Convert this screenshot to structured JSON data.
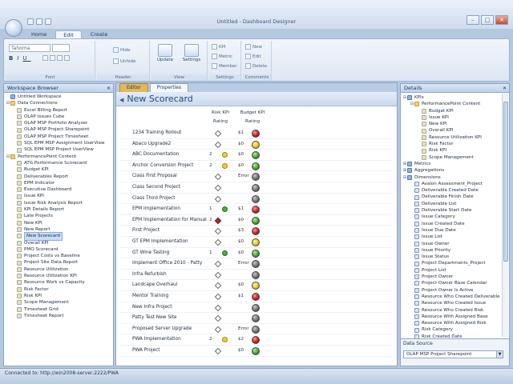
{
  "window": {
    "title": "Untitled - Dashboard Designer"
  },
  "ribbon": {
    "tabs": [
      "Home",
      "Edit",
      "Create"
    ],
    "active_tab": "Edit",
    "font": {
      "name": "Tahoma",
      "size": "",
      "group_label": "Font"
    },
    "header": {
      "hide": "Hide",
      "unhide": "Unhide",
      "group_label": "Header"
    },
    "view": {
      "update": "Update",
      "settings": "Settings",
      "group_label": "View"
    },
    "settings": {
      "kpi": "KPI",
      "metric": "Metric",
      "member": "Member",
      "group_label": "Settings"
    },
    "comments": {
      "new": "New",
      "edit": "Edit",
      "delete": "Delete",
      "group_label": "Comments"
    }
  },
  "workspace": {
    "title": "Workspace Browser",
    "items": [
      {
        "label": "Untitled Workspace",
        "level": 0,
        "icon": "workspace"
      },
      {
        "label": "Data Connections",
        "level": 0,
        "icon": "folder",
        "toggle": "⊟"
      },
      {
        "label": "Excel Billing Report",
        "level": 1,
        "icon": "item"
      },
      {
        "label": "OLAP Issues Cube",
        "level": 1,
        "icon": "item"
      },
      {
        "label": "OLAP MSP Portfolio Analyzer",
        "level": 1,
        "icon": "item"
      },
      {
        "label": "OLAP MSP Project Sharepoint",
        "level": 1,
        "icon": "item"
      },
      {
        "label": "OLAP MSP Project Timesheet",
        "level": 1,
        "icon": "item"
      },
      {
        "label": "SQL EPM MSP Assignment UserView",
        "level": 1,
        "icon": "item"
      },
      {
        "label": "SQL EPM MSP Project UserView",
        "level": 1,
        "icon": "item"
      },
      {
        "label": "PerformancePoint Content",
        "level": 0,
        "icon": "folder",
        "toggle": "⊟"
      },
      {
        "label": "ATG Performance Scorecard",
        "level": 1,
        "icon": "item"
      },
      {
        "label": "Budget KPI",
        "level": 1,
        "icon": "item"
      },
      {
        "label": "Deliverables Report",
        "level": 1,
        "icon": "item"
      },
      {
        "label": "EPM Indicator",
        "level": 1,
        "icon": "item"
      },
      {
        "label": "Executive Dashboard",
        "level": 1,
        "icon": "item"
      },
      {
        "label": "Issue KPI",
        "level": 1,
        "icon": "item"
      },
      {
        "label": "Issue Risk Analysis Report",
        "level": 1,
        "icon": "item"
      },
      {
        "label": "KPI Details Report",
        "level": 1,
        "icon": "item"
      },
      {
        "label": "Late Projects",
        "level": 1,
        "icon": "item"
      },
      {
        "label": "New KPI",
        "level": 1,
        "icon": "item"
      },
      {
        "label": "New Report",
        "level": 1,
        "icon": "item"
      },
      {
        "label": "New Scorecard",
        "level": 1,
        "icon": "item",
        "selected": true
      },
      {
        "label": "Overall KPI",
        "level": 1,
        "icon": "item"
      },
      {
        "label": "PMO Scorecard",
        "level": 1,
        "icon": "item"
      },
      {
        "label": "Project Costs vs Baseline",
        "level": 1,
        "icon": "item"
      },
      {
        "label": "Project Site Data Report",
        "level": 1,
        "icon": "item"
      },
      {
        "label": "Resource Utilization",
        "level": 1,
        "icon": "item"
      },
      {
        "label": "Resource Utilization KPI",
        "level": 1,
        "icon": "item"
      },
      {
        "label": "Resource Work vs Capacity",
        "level": 1,
        "icon": "item"
      },
      {
        "label": "Risk Factor",
        "level": 1,
        "icon": "item"
      },
      {
        "label": "Risk KPI",
        "level": 1,
        "icon": "item"
      },
      {
        "label": "Scope Management",
        "level": 1,
        "icon": "item"
      },
      {
        "label": "Timesheet Grid",
        "level": 1,
        "icon": "item"
      },
      {
        "label": "Timesheet Report",
        "level": 1,
        "icon": "item"
      }
    ]
  },
  "editor": {
    "tabs": [
      "Editor",
      "Properties"
    ],
    "active_tab": "Properties",
    "title": "New Scorecard",
    "columns": {
      "risk_kpi": "Risk KPI",
      "budget_kpi": "Budget KPI",
      "rating1": "Rating",
      "rating2": "Rating"
    },
    "rows": [
      {
        "name": "1234 Training Rollout",
        "rnum": "",
        "rind": "diamond",
        "bval": "$1",
        "bstat": "red"
      },
      {
        "name": "Abaco Upgrade2",
        "rnum": "",
        "rind": "diamond",
        "bval": "$0",
        "bstat": "yellow"
      },
      {
        "name": "ABC Documentation",
        "rnum": "2",
        "rind": "yellow",
        "bval": "$0",
        "bstat": "green"
      },
      {
        "name": "Anchor Conversion Project",
        "rnum": "2",
        "rind": "yellow",
        "bval": "$0",
        "bstat": "green"
      },
      {
        "name": "Class First Proposal",
        "rnum": "",
        "rind": "diamond",
        "bval": "Error",
        "bstat": "gray"
      },
      {
        "name": "Class Second Project",
        "rnum": "",
        "rind": "diamond",
        "bval": "",
        "bstat": "gray"
      },
      {
        "name": "Class Third Project",
        "rnum": "",
        "rind": "diamond",
        "bval": "",
        "bstat": "gray"
      },
      {
        "name": "EPM Implementation",
        "rnum": "1",
        "rind": "green",
        "bval": "$1",
        "bstat": "red"
      },
      {
        "name": "EPM Implementation for Manual",
        "rnum": "2",
        "rind": "reddiamond",
        "bval": "$0",
        "bstat": "green"
      },
      {
        "name": "First Project",
        "rnum": "",
        "rind": "diamond",
        "bval": "$3",
        "bstat": "red"
      },
      {
        "name": "GT EPM Implementation",
        "rnum": "",
        "rind": "diamond",
        "bval": "$0",
        "bstat": "yellow"
      },
      {
        "name": "GT Wine Tasting",
        "rnum": "1",
        "rind": "green",
        "bval": "$0",
        "bstat": "green"
      },
      {
        "name": "Implement Office 2010 - Patty",
        "rnum": "",
        "rind": "diamond",
        "bval": "Error",
        "bstat": "gray"
      },
      {
        "name": "Infra Refurbish",
        "rnum": "",
        "rind": "diamond",
        "bval": "",
        "bstat": "gray"
      },
      {
        "name": "Landcape Overhaul",
        "rnum": "",
        "rind": "diamond",
        "bval": "$0",
        "bstat": "yellow"
      },
      {
        "name": "Mentor Training",
        "rnum": "",
        "rind": "diamond",
        "bval": "$1",
        "bstat": "red"
      },
      {
        "name": "New Infra Project",
        "rnum": "",
        "rind": "diamond",
        "bval": "",
        "bstat": "gray"
      },
      {
        "name": "Patty Test New Site",
        "rnum": "",
        "rind": "diamond",
        "bval": "",
        "bstat": "gray"
      },
      {
        "name": "Proposed Server Upgrade",
        "rnum": "",
        "rind": "diamond",
        "bval": "Error",
        "bstat": "gray"
      },
      {
        "name": "PWA Implementation",
        "rnum": "2",
        "rind": "yellow",
        "bval": "$2",
        "bstat": "red"
      },
      {
        "name": "PWA Project",
        "rnum": "",
        "rind": "diamond",
        "bval": "$0",
        "bstat": "green"
      }
    ]
  },
  "details": {
    "title": "Details",
    "items": [
      {
        "label": "KPIs",
        "level": 0,
        "toggle": "⊟",
        "icon": "blue"
      },
      {
        "label": "PerformancePoint Content",
        "level": 1,
        "toggle": "⊟",
        "icon": "fold"
      },
      {
        "label": "Budget KPI",
        "level": 2,
        "icon": "item"
      },
      {
        "label": "Issue KPI",
        "level": 2,
        "icon": "item"
      },
      {
        "label": "New KPI",
        "level": 2,
        "icon": "item"
      },
      {
        "label": "Overall KPI",
        "level": 2,
        "icon": "item"
      },
      {
        "label": "Resource Utilization KPI",
        "level": 2,
        "icon": "item"
      },
      {
        "label": "Risk Factor",
        "level": 2,
        "icon": "item"
      },
      {
        "label": "Risk KPI",
        "level": 2,
        "icon": "item"
      },
      {
        "label": "Scope Management",
        "level": 2,
        "icon": "item"
      },
      {
        "label": "Metrics",
        "level": 0,
        "toggle": "⊞",
        "icon": "blue"
      },
      {
        "label": "Aggregations",
        "level": 0,
        "toggle": "⊞",
        "icon": "blue"
      },
      {
        "label": "Dimensions",
        "level": 0,
        "toggle": "⊟",
        "icon": "blue"
      },
      {
        "label": "Avalon Assessment_Project",
        "level": 1,
        "icon": "dim"
      },
      {
        "label": "Deliverable Created Date",
        "level": 1,
        "icon": "dim"
      },
      {
        "label": "Deliverable Finish Date",
        "level": 1,
        "icon": "dim"
      },
      {
        "label": "Deliverable List",
        "level": 1,
        "icon": "dim"
      },
      {
        "label": "Deliverable Start Date",
        "level": 1,
        "icon": "dim"
      },
      {
        "label": "Issue Category",
        "level": 1,
        "icon": "dim"
      },
      {
        "label": "Issue Created Date",
        "level": 1,
        "icon": "dim"
      },
      {
        "label": "Issue Due Date",
        "level": 1,
        "icon": "dim"
      },
      {
        "label": "Issue List",
        "level": 1,
        "icon": "dim"
      },
      {
        "label": "Issue Owner",
        "level": 1,
        "icon": "dim"
      },
      {
        "label": "Issue Priority",
        "level": 1,
        "icon": "dim"
      },
      {
        "label": "Issue Status",
        "level": 1,
        "icon": "dim"
      },
      {
        "label": "Project Departments_Project",
        "level": 1,
        "icon": "dim"
      },
      {
        "label": "Project List",
        "level": 1,
        "icon": "dim"
      },
      {
        "label": "Project Owner",
        "level": 1,
        "icon": "dim"
      },
      {
        "label": "Project Owner Base Calendar",
        "level": 1,
        "icon": "dim"
      },
      {
        "label": "Project Owner Is Active",
        "level": 1,
        "icon": "dim"
      },
      {
        "label": "Resource Who Created Deliverable",
        "level": 1,
        "icon": "dim"
      },
      {
        "label": "Resource Who Created Issue",
        "level": 1,
        "icon": "dim"
      },
      {
        "label": "Resource Who Created Risk",
        "level": 1,
        "icon": "dim"
      },
      {
        "label": "Resource With Assigned Base",
        "level": 1,
        "icon": "dim"
      },
      {
        "label": "Resource With Assigned Risk",
        "level": 1,
        "icon": "dim"
      },
      {
        "label": "Risk Category",
        "level": 1,
        "icon": "dim"
      },
      {
        "label": "Risk Created Date",
        "level": 1,
        "icon": "dim"
      }
    ],
    "data_source_label": "Data Source",
    "data_source_value": "OLAP MSP Project Sharepoint"
  },
  "status": {
    "text": "Connected to: http://win2008-server:2222/PWA"
  }
}
